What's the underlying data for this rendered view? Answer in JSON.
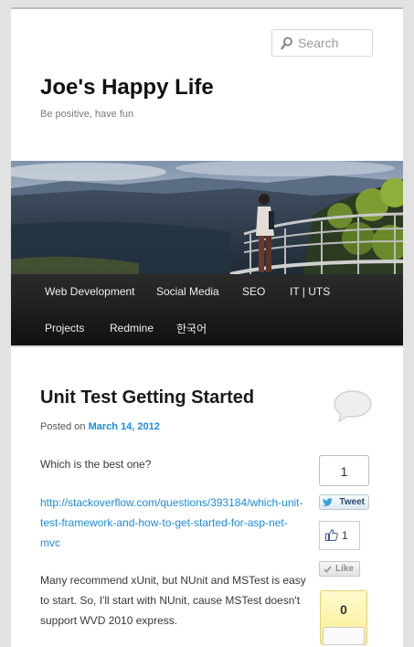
{
  "search": {
    "placeholder": "Search"
  },
  "site": {
    "title": "Joe's Happy Life",
    "description": "Be positive, have fun"
  },
  "nav": {
    "items": [
      "Web Development",
      "Social Media",
      "SEO",
      "IT | UTS",
      "Projects",
      "Redmine",
      "한국어"
    ]
  },
  "post": {
    "title": "Unit Test Getting Started",
    "posted_on_label": "Posted on",
    "date": "March 14, 2012",
    "paragraph1": "Which is the best one?",
    "link": "http://stackoverflow.com/questions/393184/which-unit-test-framework-and-how-to-get-started-for-asp-net-mvc",
    "paragraph3": "Many recommend xUnit, but NUnit and MSTest is easy to start. So, I'll start with NUnit, cause MSTest doesn't support WVD 2010 express."
  },
  "social": {
    "tweet_count": "1",
    "tweet_label": "Tweet",
    "fb_count": "1",
    "fb_like_label": "Like",
    "plusone_count": "0"
  },
  "colors": {
    "link": "#1b8be0",
    "nav_bg": "#1e1e1e"
  }
}
